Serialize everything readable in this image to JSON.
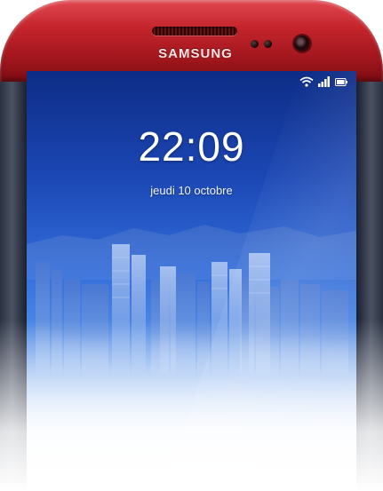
{
  "device": {
    "brand": "SAMSUNG"
  },
  "status_bar": {
    "icons": [
      "wifi-icon",
      "signal-icon",
      "battery-icon"
    ]
  },
  "lock_screen": {
    "time": "22:09",
    "date": "jeudi 10 octobre"
  },
  "colors": {
    "bezel": "#c4242c",
    "screen_top": "#0d2c86",
    "screen_mid": "#2f68d6"
  }
}
